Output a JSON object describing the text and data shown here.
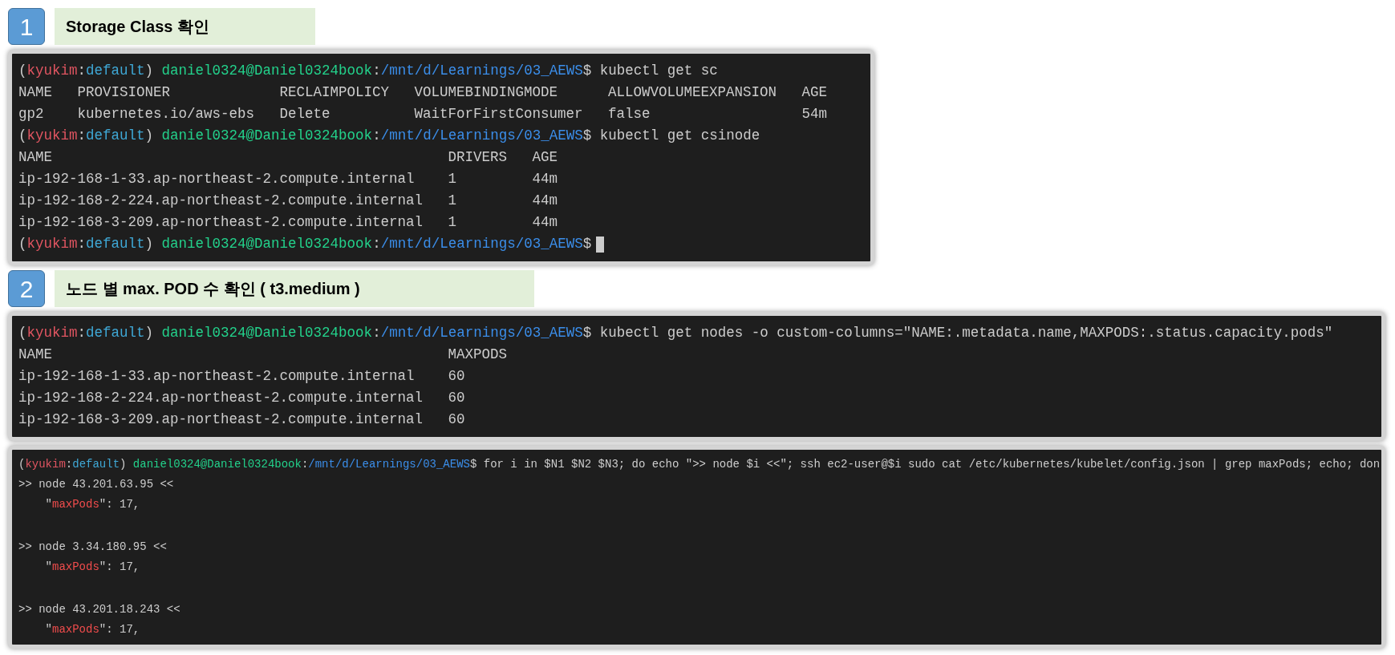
{
  "sections": [
    {
      "number": "1",
      "title": "Storage Class 확인",
      "terminals": [
        {
          "cursor": true,
          "lines": [
            {
              "kind": "prompt",
              "segments": [
                {
                  "kind": "plain",
                  "text": "("
                },
                {
                  "kind": "user",
                  "text": "kyukim"
                },
                {
                  "kind": "plain",
                  "text": ":"
                },
                {
                  "kind": "context",
                  "text": "default"
                },
                {
                  "kind": "plain",
                  "text": ") "
                },
                {
                  "kind": "host",
                  "text": "daniel0324@Daniel0324book"
                },
                {
                  "kind": "plain",
                  "text": ":"
                },
                {
                  "kind": "path",
                  "text": "/mnt/d/Learnings/03_AEWS"
                },
                {
                  "kind": "plain",
                  "text": "$ kubectl get sc"
                }
              ]
            },
            {
              "kind": "table",
              "columns": [
                "NAME",
                "PROVISIONER",
                "RECLAIMPOLICY",
                "VOLUMEBINDINGMODE",
                "ALLOWVOLUMEEXPANSION",
                "AGE"
              ],
              "rows": [
                [
                  "gp2",
                  "kubernetes.io/aws-ebs",
                  "Delete",
                  "WaitForFirstConsumer",
                  "false",
                  "54m"
                ]
              ]
            },
            {
              "kind": "prompt",
              "segments": [
                {
                  "kind": "plain",
                  "text": "("
                },
                {
                  "kind": "user",
                  "text": "kyukim"
                },
                {
                  "kind": "plain",
                  "text": ":"
                },
                {
                  "kind": "context",
                  "text": "default"
                },
                {
                  "kind": "plain",
                  "text": ") "
                },
                {
                  "kind": "host",
                  "text": "daniel0324@Daniel0324book"
                },
                {
                  "kind": "plain",
                  "text": ":"
                },
                {
                  "kind": "path",
                  "text": "/mnt/d/Learnings/03_AEWS"
                },
                {
                  "kind": "plain",
                  "text": "$ kubectl get csinode"
                }
              ]
            },
            {
              "kind": "table",
              "columns": [
                "NAME",
                "DRIVERS",
                "AGE"
              ],
              "rows": [
                [
                  "ip-192-168-1-33.ap-northeast-2.compute.internal",
                  "1",
                  "44m"
                ],
                [
                  "ip-192-168-2-224.ap-northeast-2.compute.internal",
                  "1",
                  "44m"
                ],
                [
                  "ip-192-168-3-209.ap-northeast-2.compute.internal",
                  "1",
                  "44m"
                ]
              ]
            },
            {
              "kind": "prompt",
              "segments": [
                {
                  "kind": "plain",
                  "text": "("
                },
                {
                  "kind": "user",
                  "text": "kyukim"
                },
                {
                  "kind": "plain",
                  "text": ":"
                },
                {
                  "kind": "context",
                  "text": "default"
                },
                {
                  "kind": "plain",
                  "text": ") "
                },
                {
                  "kind": "host",
                  "text": "daniel0324@Daniel0324book"
                },
                {
                  "kind": "plain",
                  "text": ":"
                },
                {
                  "kind": "path",
                  "text": "/mnt/d/Learnings/03_AEWS"
                },
                {
                  "kind": "plain",
                  "text": "$"
                }
              ]
            }
          ]
        }
      ]
    },
    {
      "number": "2",
      "title": "노드 별 max. POD 수 확인 ( t3.medium )",
      "terminals": [
        {
          "lines": [
            {
              "kind": "prompt",
              "segments": [
                {
                  "kind": "plain",
                  "text": "("
                },
                {
                  "kind": "user",
                  "text": "kyukim"
                },
                {
                  "kind": "plain",
                  "text": ":"
                },
                {
                  "kind": "context",
                  "text": "default"
                },
                {
                  "kind": "plain",
                  "text": ") "
                },
                {
                  "kind": "host",
                  "text": "daniel0324@Daniel0324book"
                },
                {
                  "kind": "plain",
                  "text": ":"
                },
                {
                  "kind": "path",
                  "text": "/mnt/d/Learnings/03_AEWS"
                },
                {
                  "kind": "plain",
                  "text": "$ kubectl get nodes -o custom-columns=\"NAME:.metadata.name,MAXPODS:.status.capacity.pods\""
                }
              ]
            },
            {
              "kind": "table",
              "columns": [
                "NAME",
                "MAXPODS"
              ],
              "rows": [
                [
                  "ip-192-168-1-33.ap-northeast-2.compute.internal",
                  "60"
                ],
                [
                  "ip-192-168-2-224.ap-northeast-2.compute.internal",
                  "60"
                ],
                [
                  "ip-192-168-3-209.ap-northeast-2.compute.internal",
                  "60"
                ]
              ]
            }
          ]
        },
        {
          "small": true,
          "lines": [
            {
              "kind": "prompt",
              "segments": [
                {
                  "kind": "plain",
                  "text": "("
                },
                {
                  "kind": "user",
                  "text": "kyukim"
                },
                {
                  "kind": "plain",
                  "text": ":"
                },
                {
                  "kind": "context",
                  "text": "default"
                },
                {
                  "kind": "plain",
                  "text": ") "
                },
                {
                  "kind": "host",
                  "text": "daniel0324@Daniel0324book"
                },
                {
                  "kind": "plain",
                  "text": ":"
                },
                {
                  "kind": "path",
                  "text": "/mnt/d/Learnings/03_AEWS"
                },
                {
                  "kind": "plain",
                  "text": "$ for i in $N1 $N2 $N3; do echo \">> node $i <<\"; ssh ec2-user@$i sudo cat /etc/kubernetes/kubelet/config.json | grep maxPods; echo; don"
                }
              ]
            },
            {
              "kind": "output",
              "segments": [
                {
                  "kind": "plain",
                  "text": ">> node 43.201.63.95 <<"
                }
              ]
            },
            {
              "kind": "output",
              "indent": true,
              "segments": [
                {
                  "kind": "plain",
                  "text": "\""
                },
                {
                  "kind": "key",
                  "text": "maxPods"
                },
                {
                  "kind": "plain",
                  "text": "\": 17,"
                }
              ]
            },
            {
              "kind": "blank"
            },
            {
              "kind": "output",
              "segments": [
                {
                  "kind": "plain",
                  "text": ">> node 3.34.180.95 <<"
                }
              ]
            },
            {
              "kind": "output",
              "indent": true,
              "segments": [
                {
                  "kind": "plain",
                  "text": "\""
                },
                {
                  "kind": "key",
                  "text": "maxPods"
                },
                {
                  "kind": "plain",
                  "text": "\": 17,"
                }
              ]
            },
            {
              "kind": "blank"
            },
            {
              "kind": "output",
              "segments": [
                {
                  "kind": "plain",
                  "text": ">> node 43.201.18.243 <<"
                }
              ]
            },
            {
              "kind": "output",
              "indent": true,
              "segments": [
                {
                  "kind": "plain",
                  "text": "\""
                },
                {
                  "kind": "key",
                  "text": "maxPods"
                },
                {
                  "kind": "plain",
                  "text": "\": 17,"
                }
              ]
            }
          ]
        }
      ]
    }
  ]
}
